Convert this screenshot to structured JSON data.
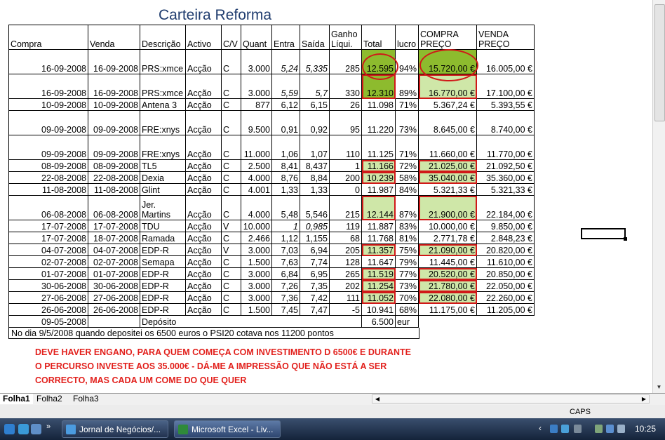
{
  "title": "Carteira Reforma",
  "headers": [
    "Compra",
    "Venda",
    "Descrição",
    "Activo",
    "C/V",
    "Quant",
    "Entra",
    "Saída",
    "Ganho Líqui.",
    "Total",
    "lucro",
    "COMPRA PREÇO",
    "VENDA PREÇO"
  ],
  "rows": [
    [
      "16-09-2008",
      "16-09-2008",
      "PRS:xmce",
      "Acção",
      "C",
      "3.000",
      "5,24",
      "5,335",
      "285",
      "12.595",
      "94%",
      "15.720,00 €",
      "16.005,00 €"
    ],
    [
      "16-09-2008",
      "16-09-2008",
      "PRS:xmce",
      "Acção",
      "C",
      "3.000",
      "5,59",
      "5,7",
      "330",
      "12.310",
      "89%",
      "16.770,00 €",
      "17.100,00 €"
    ],
    [
      "10-09-2008",
      "10-09-2008",
      "Antena 3",
      "Acção",
      "C",
      "877",
      "6,12",
      "6,15",
      "26",
      "11.098",
      "71%",
      "5.367,24 €",
      "5.393,55 €"
    ],
    [
      "09-09-2008",
      "09-09-2008",
      "FRE:xnys",
      "Acção",
      "C",
      "9.500",
      "0,91",
      "0,92",
      "95",
      "11.220",
      "73%",
      "8.645,00 €",
      "8.740,00 €"
    ],
    [
      "09-09-2008",
      "09-09-2008",
      "FRE:xnys",
      "Acção",
      "C",
      "11.000",
      "1,06",
      "1,07",
      "110",
      "11.125",
      "71%",
      "11.660,00 €",
      "11.770,00 €"
    ],
    [
      "08-09-2008",
      "08-09-2008",
      "TL5",
      "Acção",
      "C",
      "2.500",
      "8,41",
      "8,437",
      "1",
      "11.166",
      "72%",
      "21.025,00 €",
      "21.092,50 €"
    ],
    [
      "22-08-2008",
      "22-08-2008",
      "Dexia",
      "Acção",
      "C",
      "4.000",
      "8,76",
      "8,84",
      "200",
      "10.239",
      "58%",
      "35.040,00 €",
      "35.360,00 €"
    ],
    [
      "11-08-2008",
      "11-08-2008",
      "Glint",
      "Acção",
      "C",
      "4.001",
      "1,33",
      "1,33",
      "0",
      "11.987",
      "84%",
      "5.321,33 €",
      "5.321,33 €"
    ],
    [
      "06-08-2008",
      "06-08-2008",
      "Jer. Martins",
      "Acção",
      "C",
      "4.000",
      "5,48",
      "5,546",
      "215",
      "12.144",
      "87%",
      "21.900,00 €",
      "22.184,00 €"
    ],
    [
      "17-07-2008",
      "17-07-2008",
      "TDU",
      "Acção",
      "V",
      "10.000",
      "1",
      "0,985",
      "119",
      "11.887",
      "83%",
      "10.000,00 €",
      "9.850,00 €"
    ],
    [
      "17-07-2008",
      "18-07-2008",
      "Ramada",
      "Acção",
      "C",
      "2.466",
      "1,12",
      "1,155",
      "68",
      "11.768",
      "81%",
      "2.771,78 €",
      "2.848,23 €"
    ],
    [
      "04-07-2008",
      "04-07-2008",
      "EDP-R",
      "Acção",
      "V",
      "3.000",
      "7,03",
      "6,94",
      "205",
      "11.357",
      "75%",
      "21.090,00 €",
      "20.820,00 €"
    ],
    [
      "02-07-2008",
      "02-07-2008",
      "Semapa",
      "Acção",
      "C",
      "1.500",
      "7,63",
      "7,74",
      "128",
      "11.647",
      "79%",
      "11.445,00 €",
      "11.610,00 €"
    ],
    [
      "01-07-2008",
      "01-07-2008",
      "EDP-R",
      "Acção",
      "C",
      "3.000",
      "6,84",
      "6,95",
      "265",
      "11.519",
      "77%",
      "20.520,00 €",
      "20.850,00 €"
    ],
    [
      "30-06-2008",
      "30-06-2008",
      "EDP-R",
      "Acção",
      "C",
      "3.000",
      "7,26",
      "7,35",
      "202",
      "11.254",
      "73%",
      "21.780,00 €",
      "22.050,00 €"
    ],
    [
      "27-06-2008",
      "27-06-2008",
      "EDP-R",
      "Acção",
      "C",
      "3.000",
      "7,36",
      "7,42",
      "111",
      "11.052",
      "70%",
      "22.080,00 €",
      "22.260,00 €"
    ],
    [
      "26-06-2008",
      "26-06-2008",
      "EDP-R",
      "Acção",
      "C",
      "1.500",
      "7,45",
      "7,47",
      "-5",
      "10.941",
      "68%",
      "11.175,00 €",
      "11.205,00 €"
    ]
  ],
  "deposit_row": {
    "date": "09-05-2008",
    "label": "Depósito",
    "amount": "6.500",
    "unit": "eur"
  },
  "note": "No dia 9/5/2008 quando depositei os 6500 euros o PSI20 cotava nos 11200 pontos",
  "comment_lines": [
    "DEVE HAVER ENGANO,  PARA QUEM COMEÇA COM INVESTIMENTO D 6500€ E DURANTE",
    "O PERCURSO INVESTE AOS 35.000€ - DÁ-ME A IMPRESSÃO QUE NÃO ESTÁ A SER",
    "CORRECTO, MAS CADA UM COME DO QUE QUER"
  ],
  "sheet_tabs": [
    "Folha1",
    "Folha2",
    "Folha3"
  ],
  "status": {
    "caps": "CAPS"
  },
  "taskbar": {
    "buttons": [
      "Jornal de Negócios/...",
      "Microsoft Excel - Liv..."
    ],
    "clock": "10:25"
  },
  "colors": {
    "highlight_green": "#cfe7a8",
    "dark_green": "#8dbb2e",
    "red_box": "#d01818",
    "comment_red": "#e2201c",
    "title_blue": "#1f3c6e"
  }
}
